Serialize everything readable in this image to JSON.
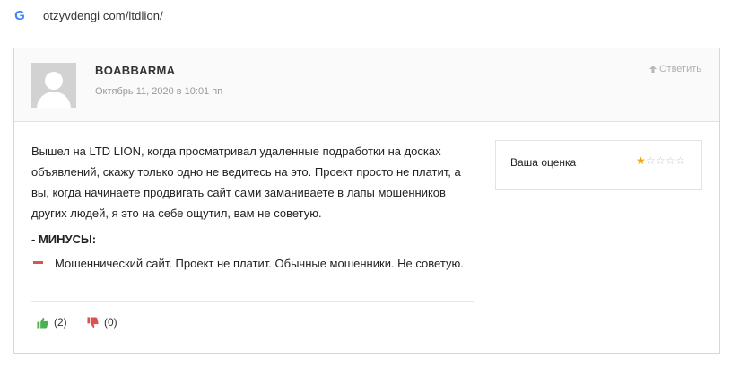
{
  "browser": {
    "logo_letter": "G",
    "url": "otzyvdengi com/ltdlion/"
  },
  "comment": {
    "author": "BOABBARMA",
    "date": "Октябрь 11, 2020 в 10:01 пп",
    "reply_label": "Ответить",
    "body": "Вышел на LTD LION, когда просматривал удаленные подработки на досках объявлений, скажу только одно не ведитесь на это. Проект просто не платит, а вы, когда начинаете продвигать сайт сами заманиваете в лапы мошенников других людей, я это на себе ощутил, вам не советую.",
    "minus_title": "- МИНУСЫ:",
    "minus_text": "Мошеннический сайт. Проект не платит. Обычные мошенники. Не советую.",
    "likes": "(2)",
    "dislikes": "(0)"
  },
  "rating": {
    "label": "Ваша оценка",
    "value": 1,
    "max": 5
  },
  "colors": {
    "like": "#4caf50",
    "dislike": "#d9534f",
    "star": "#f0a30a",
    "minus_marker": "#d9534f"
  },
  "icons": {
    "reply": "arrow-up-icon",
    "like": "thumbs-up-icon",
    "dislike": "thumbs-down-icon",
    "avatar": "user-placeholder-icon"
  }
}
